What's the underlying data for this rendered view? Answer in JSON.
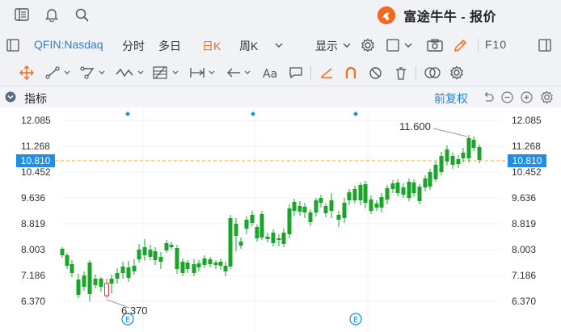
{
  "app": {
    "title": "富途牛牛 - 报价"
  },
  "toolbar": {
    "ticker": "QFIN:Nasdaq",
    "tabs": [
      "分时",
      "多日",
      "日K",
      "周K"
    ],
    "active_tab": "日K",
    "display_label": "显示",
    "f10_label": "F10"
  },
  "indicator_bar": {
    "label": "指标",
    "adjust_label": "前复权"
  },
  "chart": {
    "y_ticks": [
      "12.085",
      "11.268",
      "10.452",
      "9.636",
      "8.819",
      "8.003",
      "7.186",
      "6.370"
    ],
    "current_price": "10.810",
    "high_label": "11.600",
    "low_label": "6.370",
    "earnings_marker": "E",
    "colors": {
      "up": "#d9363e",
      "down": "#1aa52a",
      "accent": "#1f8fe6",
      "current_line": "#f5a623"
    }
  }
}
